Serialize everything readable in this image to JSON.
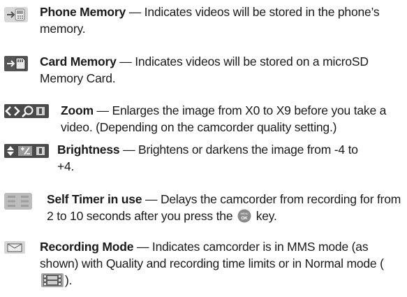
{
  "entries": [
    {
      "term": "Phone Memory",
      "sep": " — ",
      "desc": "Indicates videos will be stored in the phone’s memory.",
      "icon": "phone-memory-icon"
    },
    {
      "term": "Card Memory",
      "sep": " — ",
      "desc": "Indicates videos will be stored on a microSD Memory Card.",
      "icon": "card-memory-icon"
    },
    {
      "term": "Zoom",
      "sep": " — ",
      "desc": "Enlarges the image from X0 to X9 before you take a video. (Depending on the camcorder quality setting.)",
      "icon": "zoom-icon"
    },
    {
      "term": "Brightness",
      "sep": " — ",
      "desc": "Brightens or darkens the image from -4 to +4.",
      "icon": "brightness-icon"
    },
    {
      "term": "Self Timer in use",
      "sep": " — ",
      "desc_a": "Delays the camcorder from recording for from 2 to 10 seconds after you press the",
      "desc_b": " key.",
      "icon": "self-timer-icon",
      "inline_icon": "ok-key-icon"
    },
    {
      "term": "Recording Mode",
      "sep": " — ",
      "desc_a": "Indicates camcorder is in MMS mode (as shown) with Quality and recording time limits or in Normal mode (",
      "desc_b": ").",
      "icon": "recording-mode-icon",
      "inline_icon": "normal-mode-film-icon"
    }
  ]
}
